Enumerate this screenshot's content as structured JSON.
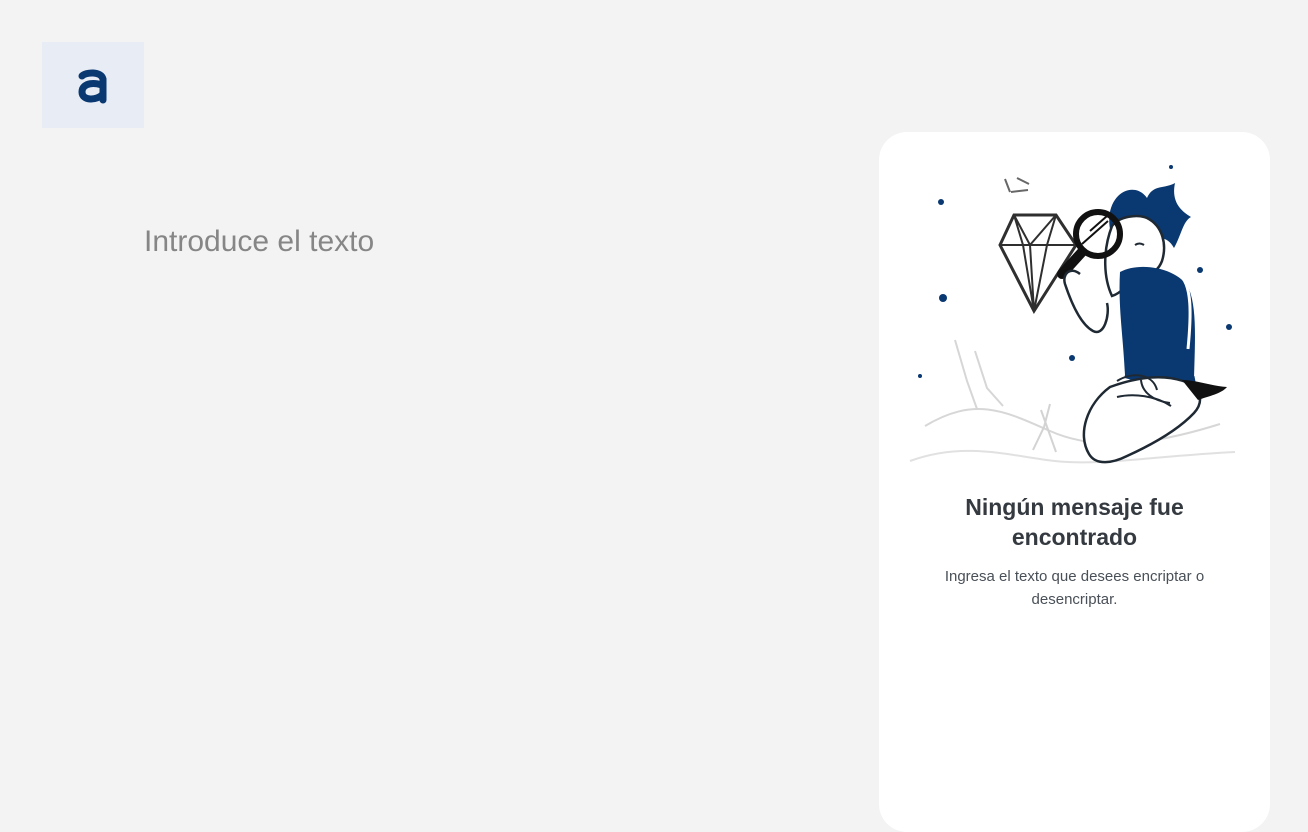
{
  "brand": {
    "logo_letter": "a",
    "logo_color": "#0a3871",
    "logo_bg": "#e8edf5"
  },
  "editor": {
    "placeholder": "Introduce el texto",
    "value": ""
  },
  "result_panel": {
    "illustration": "person-with-magnifying-glass-and-diamond-illustration",
    "title": "Ningún mensaje fue encontrado",
    "text": "Ingresa el texto que desees encriptar o desencriptar."
  },
  "colors": {
    "background": "#f3f3f3",
    "accent": "#0a3871",
    "panel": "#ffffff"
  }
}
